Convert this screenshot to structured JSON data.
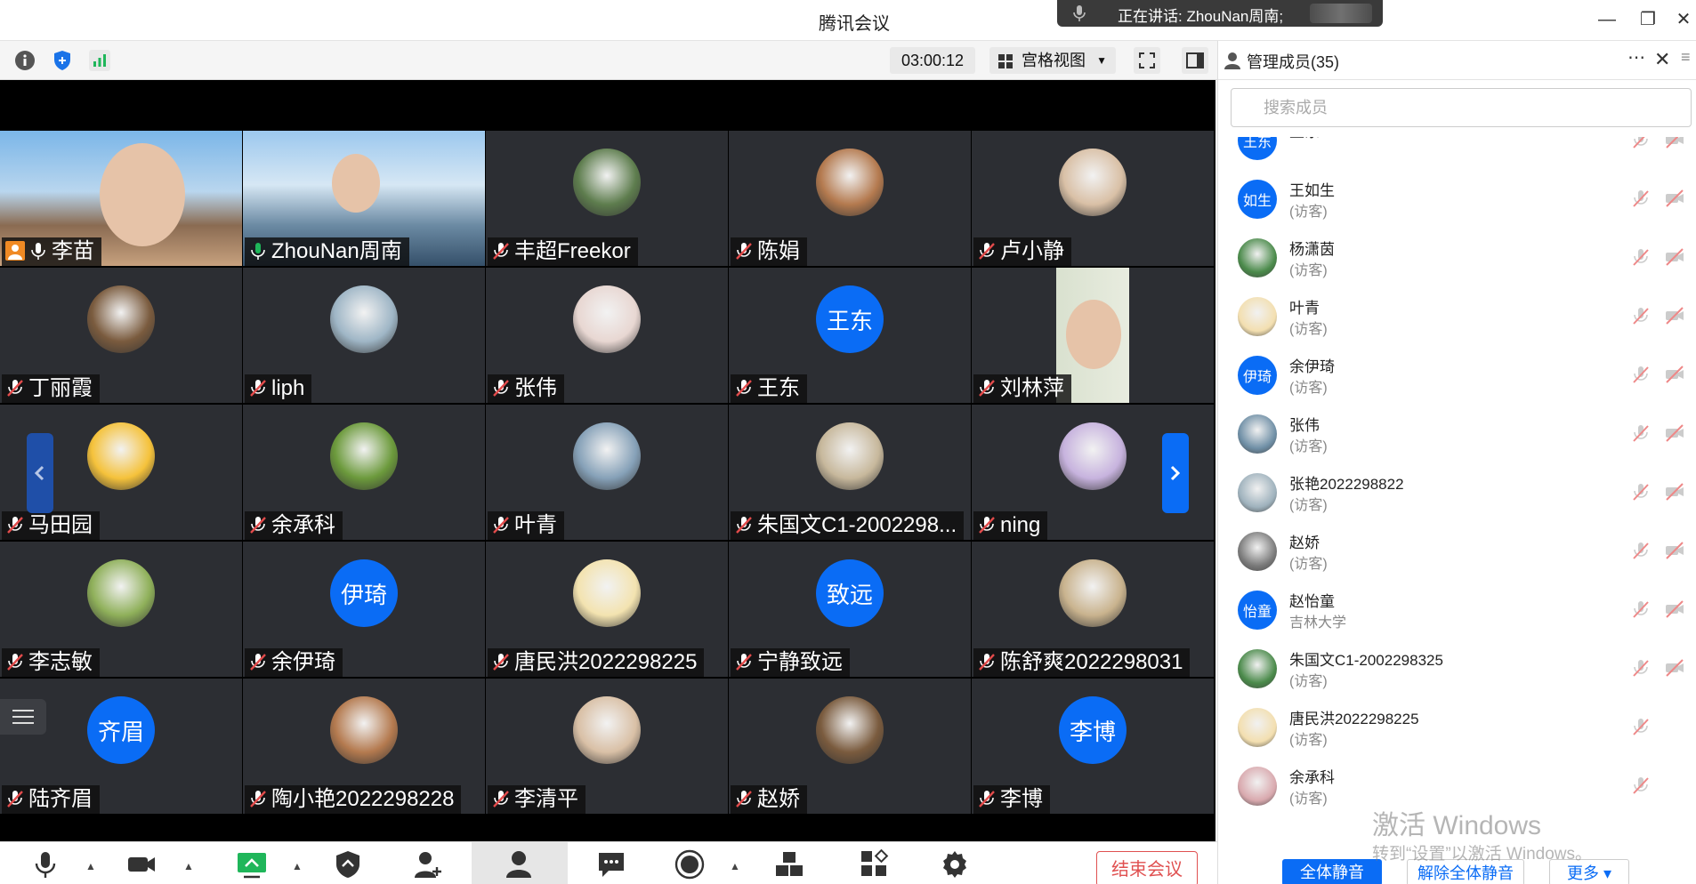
{
  "title": "腾讯会议",
  "speaking_label": "正在讲话: ZhouNan周南;",
  "timer": "03:00:12",
  "view_mode": "宫格视图",
  "tiles": [
    {
      "name": "李苗",
      "kind": "video",
      "active": false
    },
    {
      "name": "ZhouNan周南",
      "kind": "video",
      "active": true
    },
    {
      "name": "丰超Freekor",
      "kind": "photo"
    },
    {
      "name": "陈娟",
      "kind": "photo"
    },
    {
      "name": "卢小静",
      "kind": "photo"
    },
    {
      "name": "丁丽霞",
      "kind": "photo"
    },
    {
      "name": "liph",
      "kind": "photo"
    },
    {
      "name": "张伟",
      "kind": "photo"
    },
    {
      "name": "王东",
      "kind": "text",
      "avatar_text": "王东"
    },
    {
      "name": "刘林萍",
      "kind": "video"
    },
    {
      "name": "马田园",
      "kind": "photo"
    },
    {
      "name": "余承科",
      "kind": "photo"
    },
    {
      "name": "叶青",
      "kind": "photo"
    },
    {
      "name": "朱国文C1-2002298...",
      "kind": "photo"
    },
    {
      "name": "ning",
      "kind": "photo"
    },
    {
      "name": "李志敏",
      "kind": "photo"
    },
    {
      "name": "余伊琦",
      "kind": "text",
      "avatar_text": "伊琦"
    },
    {
      "name": "唐民洪2022298225",
      "kind": "photo"
    },
    {
      "name": "宁静致远",
      "kind": "text",
      "avatar_text": "致远"
    },
    {
      "name": "陈舒爽2022298031",
      "kind": "photo"
    },
    {
      "name": "陆齐眉",
      "kind": "text",
      "avatar_text": "齐眉"
    },
    {
      "name": "陶小艳2022298228",
      "kind": "photo"
    },
    {
      "name": "李清平",
      "kind": "photo"
    },
    {
      "name": "赵娇",
      "kind": "photo"
    },
    {
      "name": "李博",
      "kind": "text",
      "avatar_text": "李博"
    }
  ],
  "panel": {
    "title": "管理成员(35)",
    "search_placeholder": "搜索成员",
    "members": [
      {
        "avatar_text": "王东",
        "name": "王东",
        "role": ""
      },
      {
        "avatar_text": "如生",
        "name": "王如生",
        "role": "(访客)"
      },
      {
        "avatar_text": "",
        "name": "杨潇茵",
        "role": "(访客)"
      },
      {
        "avatar_text": "",
        "name": "叶青",
        "role": "(访客)"
      },
      {
        "avatar_text": "伊琦",
        "name": "余伊琦",
        "role": "(访客)"
      },
      {
        "avatar_text": "",
        "name": "张伟",
        "role": "(访客)"
      },
      {
        "avatar_text": "",
        "name": "张艳2022298822",
        "role": "(访客)"
      },
      {
        "avatar_text": "",
        "name": "赵娇",
        "role": "(访客)"
      },
      {
        "avatar_text": "怡童",
        "name": "赵怡童",
        "role": "吉林大学"
      },
      {
        "avatar_text": "",
        "name": "朱国文C1-2002298325",
        "role": "(访客)"
      },
      {
        "avatar_text": "",
        "name": "唐民洪2022298225",
        "role": "(访客)"
      },
      {
        "avatar_text": "",
        "name": "余承科",
        "role": "(访客)"
      }
    ],
    "mute_all": "全体静音",
    "unmute_all": "解除全体静音",
    "more": "更多"
  },
  "watermark": {
    "line1": "激活 Windows",
    "line2": "转到“设置”以激活 Windows。"
  },
  "end_meeting": "结束会议",
  "colors": {
    "accent": "#0a6cf5",
    "active_border": "#1fb65a",
    "danger": "#e05151"
  }
}
